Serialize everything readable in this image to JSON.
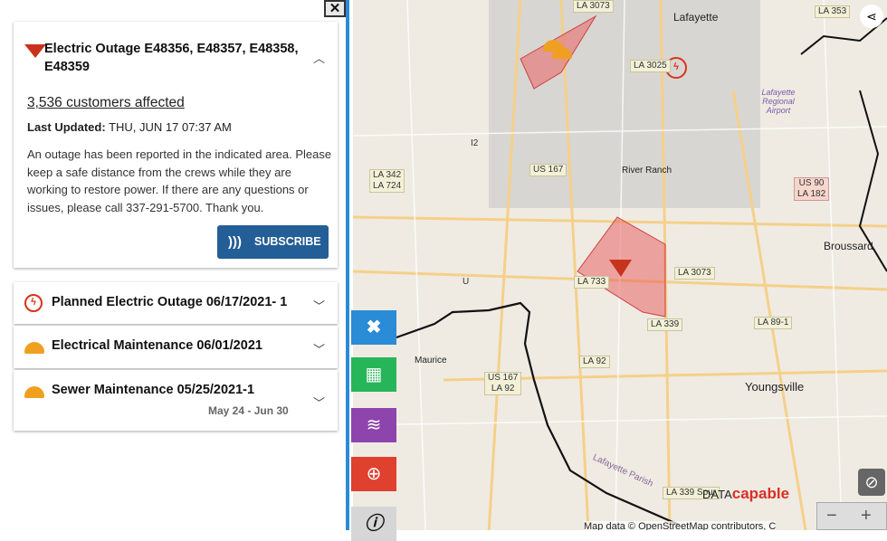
{
  "panel": {
    "close_label": "✕",
    "outage": {
      "title": "Electric Outage E48356, E48357, E48358, E48359",
      "customers": "3,536 customers affected",
      "last_updated_label": "Last Updated:",
      "last_updated_value": "THU, JUN 17 07:37 AM",
      "message": "An outage has been reported in the indicated area. Please keep a safe distance from the crews while they are working to restore power. If there are any questions or issues, please call 337-291-5700. Thank you.",
      "subscribe_label": "SUBSCRIBE",
      "icon": "red-triangle-icon"
    },
    "items": [
      {
        "title": "Planned Electric Outage 06/17/2021- 1",
        "icon": "stopwatch-bolt-icon"
      },
      {
        "title": "Electrical Maintenance 06/01/2021",
        "icon": "hard-hat-icon"
      },
      {
        "title": "Sewer Maintenance 05/25/2021-1",
        "subtitle": "May 24 - Jun 30",
        "icon": "hard-hat-icon"
      }
    ]
  },
  "toolbar": {
    "colors": {
      "close": "#2a8bd6",
      "table": "#27b55a",
      "layers": "#8e44ad",
      "globe": "#e0402e",
      "info": "#d6d6d6"
    }
  },
  "map": {
    "labels": [
      "LA 3073",
      "LA 353",
      "LA 3025",
      "LA 342\nLA 724",
      "US 167",
      "US 90\nLA 182",
      "LA 3073",
      "LA 733",
      "LA 339",
      "LA 89-1",
      "LA 92",
      "US 167\nLA 92",
      "I2",
      "U",
      "LA 339 Spur"
    ],
    "towns": [
      "Lafayette",
      "Lafayette Regional Airport",
      "River Ranch",
      "Broussard",
      "Maurice",
      "Youngsville",
      "Lafayette Parish"
    ],
    "attribution": "Map data © OpenStreetMap contributors, C",
    "logo": "DATAcapable",
    "zoom_out": "−",
    "zoom_in": "+"
  }
}
